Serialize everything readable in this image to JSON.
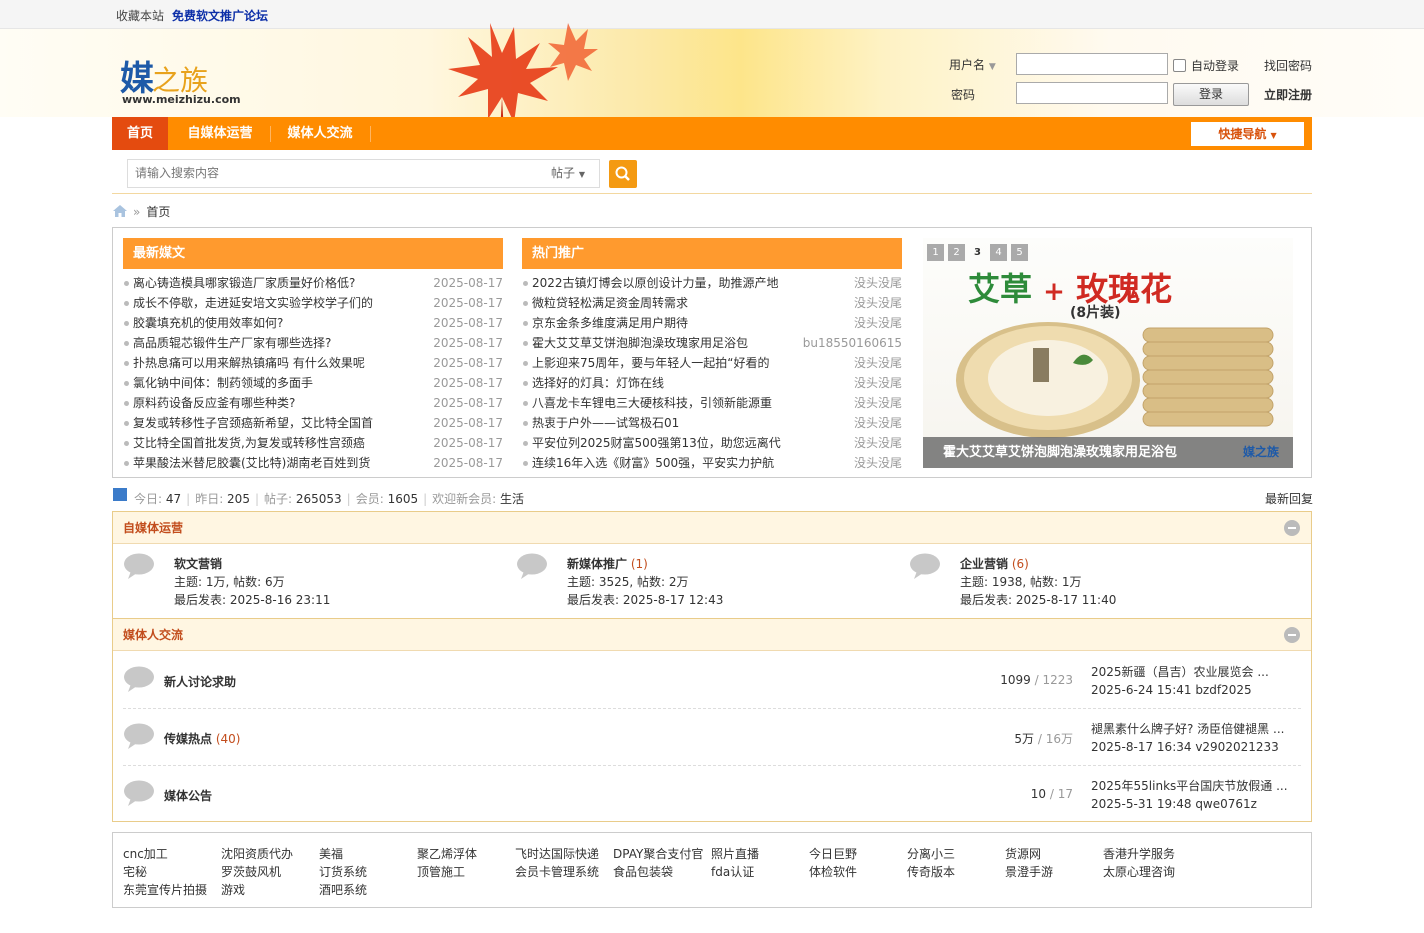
{
  "topbar": {
    "favorite": "收藏本站",
    "forum_link": "免费软文推广论坛"
  },
  "logo": {
    "mei": "媒",
    "zhizu": "之族",
    "url": "www.meizhizu.com"
  },
  "login": {
    "username_label": "用户名",
    "password_label": "密码",
    "auto_login": "自动登录",
    "login_button": "登录",
    "find_password": "找回密码",
    "register": "立即注册"
  },
  "nav": {
    "items": [
      "首页",
      "自媒体运营",
      "媒体人交流"
    ],
    "quick": "快捷导航"
  },
  "search": {
    "placeholder": "请输入搜索内容",
    "type": "帖子"
  },
  "breadcrumb": {
    "home": "首页"
  },
  "latest": {
    "title": "最新媒文",
    "items": [
      {
        "t": "离心铸造模具哪家锻造厂家质量好价格低?",
        "d": "2025-08-17"
      },
      {
        "t": "成长不停歇，走进延安培文实验学校学子们的",
        "d": "2025-08-17"
      },
      {
        "t": "胶囊填充机的使用效率如何?",
        "d": "2025-08-17"
      },
      {
        "t": "高品质辊芯锻件生产厂家有哪些选择?",
        "d": "2025-08-17"
      },
      {
        "t": "扑热息痛可以用来解热镇痛吗 有什么效果呢",
        "d": "2025-08-17"
      },
      {
        "t": "氯化钠中间体：制药领域的多面手",
        "d": "2025-08-17"
      },
      {
        "t": "原料药设备反应釜有哪些种类?",
        "d": "2025-08-17"
      },
      {
        "t": "复发或转移性子宫颈癌新希望，艾比特全国首",
        "d": "2025-08-17"
      },
      {
        "t": "艾比特全国首批发货,为复发或转移性宫颈癌",
        "d": "2025-08-17"
      },
      {
        "t": "苹果酸法米替尼胶囊(艾比特)湖南老百姓到货",
        "d": "2025-08-17"
      }
    ]
  },
  "hot": {
    "title": "热门推广",
    "items": [
      {
        "t": "2022古镇灯博会以原创设计力量，助推源产地",
        "d": "没头没尾"
      },
      {
        "t": "微粒贷轻松满足资金周转需求",
        "d": "没头没尾"
      },
      {
        "t": "京东金条多维度满足用户期待",
        "d": "没头没尾"
      },
      {
        "t": "霍大艾艾草艾饼泡脚泡澡玫瑰家用足浴包",
        "d": "bu18550160615"
      },
      {
        "t": "上影迎来75周年，要与年轻人一起拍“好看的",
        "d": "没头没尾"
      },
      {
        "t": "选择好的灯具：灯饰在线",
        "d": "没头没尾"
      },
      {
        "t": "八喜龙卡车锂电三大硬核科技，引领新能源重",
        "d": "没头没尾"
      },
      {
        "t": "热衷于户外——试驾极石01",
        "d": "没头没尾"
      },
      {
        "t": "平安位列2025财富500强第13位，助您远离代",
        "d": "没头没尾"
      },
      {
        "t": "连续16年入选《财富》500强，平安实力护航",
        "d": "没头没尾"
      }
    ]
  },
  "slider": {
    "pages": [
      "1",
      "2",
      "3",
      "4",
      "5"
    ],
    "active": 3,
    "title_a": "艾草",
    "plus": "+",
    "title_b": "玫瑰花",
    "subtitle": "(8片装)",
    "caption": "霍大艾艾草艾饼泡脚泡澡玫瑰家用足浴包",
    "watermark": "媒之族"
  },
  "stats": {
    "today_label": "今日: ",
    "today": "47",
    "yesterday_label": "昨日: ",
    "yesterday": "205",
    "posts_label": "帖子: ",
    "posts": "265053",
    "members_label": "会员: ",
    "members": "1605",
    "welcome_label": "欢迎新会员: ",
    "newest": "生活",
    "latest_reply": "最新回复"
  },
  "section1": {
    "title": "自媒体运营",
    "forums": [
      {
        "name": "软文营销",
        "count": "",
        "topics": "主题: 1万, 帖数: 6万",
        "last": "最后发表: 2025-8-16 23:11"
      },
      {
        "name": "新媒体推广",
        "count": " (1)",
        "topics": "主题: 3525, 帖数: 2万",
        "last": "最后发表: 2025-8-17 12:43"
      },
      {
        "name": "企业营销",
        "count": " (6)",
        "topics": "主题: 1938, 帖数: 1万",
        "last": "最后发表: 2025-8-17 11:40"
      }
    ]
  },
  "section2": {
    "title": "媒体人交流",
    "forums": [
      {
        "name": "新人讨论求助",
        "count": "",
        "threads": "1099",
        "posts": " / 1223",
        "last_title": "2025新疆（昌吉）农业展览会 ...",
        "last_meta": "2025-6-24 15:41 bzdf2025"
      },
      {
        "name": "传媒热点",
        "count": " (40)",
        "threads": "5万",
        "posts": " / 16万",
        "last_title": "褪黑素什么牌子好? 汤臣倍健褪黑 ...",
        "last_meta": "2025-8-17 16:34 v2902021233"
      },
      {
        "name": "媒体公告",
        "count": "",
        "threads": "10",
        "posts": " / 17",
        "last_title": "2025年55links平台国庆节放假通 ...",
        "last_meta": "2025-5-31 19:48 qwe0761z"
      }
    ]
  },
  "links": [
    "cnc加工",
    "沈阳资质代办",
    "美福",
    "聚乙烯浮体",
    "飞时达国际快递",
    "DPAY聚合支付官",
    "照片直播",
    "今日巨野",
    "分离小三",
    "货源网",
    "香港升学服务",
    "宅秘",
    "罗茨鼓风机",
    "订货系统",
    "顶管施工",
    "会员卡管理系统",
    "食品包装袋",
    "fda认证",
    "体检软件",
    "传奇版本",
    "景澄手游",
    "太原心理咨询",
    "东莞宣传片拍摄",
    "游戏",
    "酒吧系统"
  ],
  "colors": {
    "nav": "#ff8c00",
    "nav_active": "#e44b0f",
    "panel_header": "#ff9a2e",
    "section_title": "#c24d1d"
  }
}
